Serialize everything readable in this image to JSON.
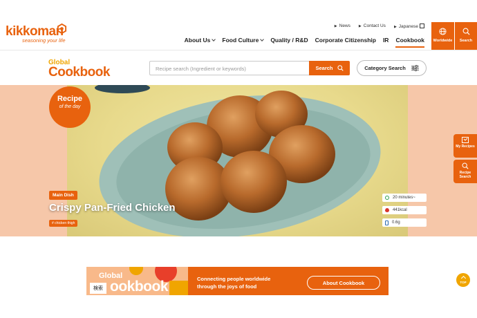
{
  "brand": {
    "name": "kikkoman",
    "tagline": "seasoning your life"
  },
  "utility_links": [
    "News",
    "Contact Us",
    "Japanese"
  ],
  "global_nav": [
    {
      "label": "About Us",
      "dropdown": true
    },
    {
      "label": "Food Culture",
      "dropdown": true
    },
    {
      "label": "Quality / R&D",
      "dropdown": false
    },
    {
      "label": "Corporate Citizenship",
      "dropdown": false
    },
    {
      "label": "IR",
      "dropdown": false
    },
    {
      "label": "Cookbook",
      "dropdown": false,
      "active": true
    }
  ],
  "header_buttons": {
    "worldwide": "Worldwide",
    "search": "Search"
  },
  "cookbook": {
    "logo_line1": "Global",
    "logo_line2": "Cookbook",
    "search_placeholder": "Recipe search (Ingredient or keywords)",
    "search_button": "Search",
    "category_button": "Category Search"
  },
  "hero": {
    "badge_line1": "Recipe",
    "badge_line2": "of the day",
    "category": "Main Dish",
    "title": "Crispy Pan-Fried Chicken",
    "tag": "# chicken thigh",
    "time": "20 minutes~",
    "calories": "441kcal",
    "salt": "0.6g"
  },
  "side_tabs": {
    "my_recipes": "My Recipes",
    "recipe_search": "Recipe Search"
  },
  "banner": {
    "logo_line1": "Global",
    "logo_line2": "ookbook",
    "kanji": "検索",
    "text_line1": "Connecting people worldwide",
    "text_line2": "through the joys of food",
    "button": "About Cookbook"
  },
  "to_top": "TOP",
  "colors": {
    "accent": "#e8620e",
    "accent_light": "#f8b98a",
    "gold": "#f0a500"
  }
}
